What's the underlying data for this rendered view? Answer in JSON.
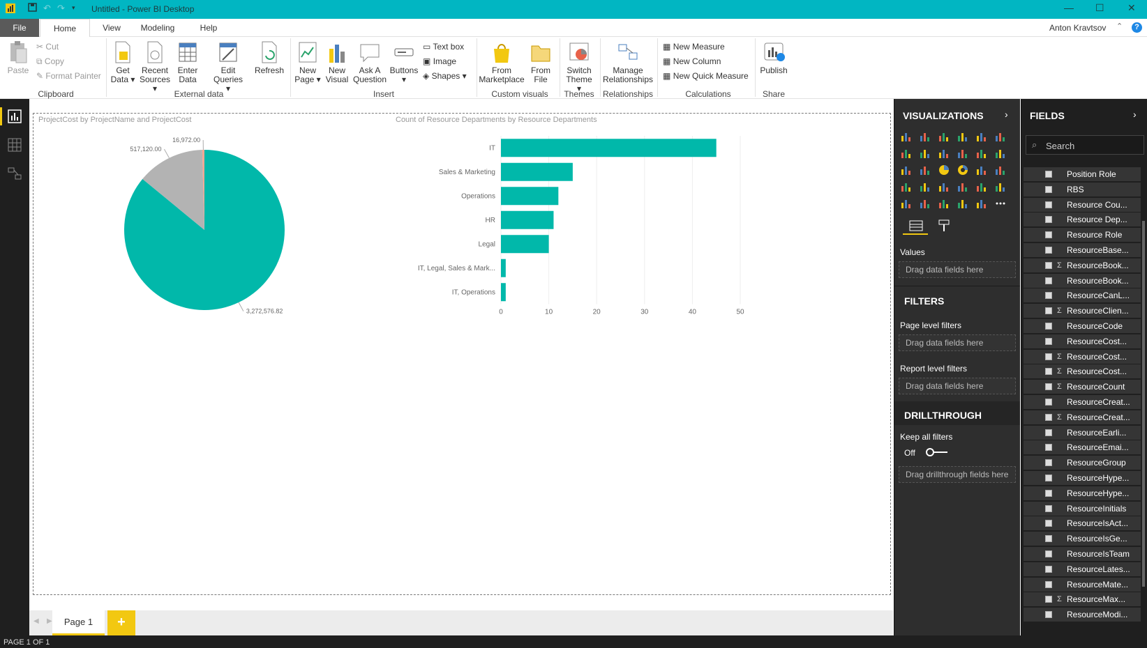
{
  "window": {
    "title": "Untitled - Power BI Desktop"
  },
  "menu": {
    "file": "File",
    "home": "Home",
    "view": "View",
    "modeling": "Modeling",
    "help": "Help",
    "user": "Anton Kravtsov",
    "help_glyph": "?"
  },
  "ribbon": {
    "clipboard": {
      "paste": "Paste",
      "cut": "Cut",
      "copy": "Copy",
      "format_painter": "Format Painter",
      "label": "Clipboard"
    },
    "external": {
      "get_data": "Get",
      "get_data2": "Data",
      "recent": "Recent",
      "recent2": "Sources",
      "enter": "Enter",
      "enter2": "Data",
      "edit": "Edit",
      "edit2": "Queries",
      "refresh": "Refresh",
      "label": "External data"
    },
    "insert": {
      "new_page": "New",
      "new_page2": "Page",
      "new_visual": "New",
      "new_visual2": "Visual",
      "ask": "Ask A",
      "ask2": "Question",
      "buttons": "Buttons",
      "text_box": "Text box",
      "image": "Image",
      "shapes": "Shapes",
      "label": "Insert"
    },
    "custom": {
      "marketplace": "From",
      "marketplace2": "Marketplace",
      "file": "From",
      "file2": "File",
      "label": "Custom visuals"
    },
    "themes": {
      "switch": "Switch",
      "switch2": "Theme",
      "label": "Themes"
    },
    "relationships": {
      "manage": "Manage",
      "manage2": "Relationships",
      "label": "Relationships"
    },
    "calculations": {
      "new_measure": "New Measure",
      "new_column": "New Column",
      "new_quick": "New Quick Measure",
      "label": "Calculations"
    },
    "share": {
      "publish": "Publish",
      "label": "Share"
    }
  },
  "pie": {
    "title": "ProjectCost by ProjectName and ProjectCost",
    "labels": [
      "16,972.00",
      "517,120.00",
      "3,272,576.82"
    ]
  },
  "chart_data": {
    "type": "bar",
    "title": "Count of Resource Departments by Resource Departments",
    "categories": [
      "IT",
      "Sales & Marketing",
      "Operations",
      "HR",
      "Legal",
      "IT, Legal, Sales & Mark...",
      "IT, Operations"
    ],
    "values": [
      45,
      15,
      12,
      11,
      10,
      1,
      1
    ],
    "xlim": [
      0,
      50
    ],
    "ticks": [
      "0",
      "10",
      "20",
      "30",
      "40",
      "50"
    ],
    "color": "#01b8aa"
  },
  "pie_data": {
    "values": [
      3272576.82,
      517120.0,
      16972.0
    ],
    "colors": [
      "#01b8aa",
      "#b3b3b3",
      "#f0a894"
    ]
  },
  "pages": {
    "page1": "Page 1",
    "add": "+"
  },
  "status": "PAGE 1 OF 1",
  "viz": {
    "title": "VISUALIZATIONS",
    "values": "Values",
    "drag1": "Drag data fields here",
    "filters": "FILTERS",
    "page_filters": "Page level filters",
    "drag2": "Drag data fields here",
    "report_filters": "Report level filters",
    "drag3": "Drag data fields here",
    "drill": "DRILLTHROUGH",
    "keep": "Keep all filters",
    "off": "Off",
    "drag4": "Drag drillthrough fields here"
  },
  "fields_panel": {
    "title": "FIELDS",
    "search_placeholder": "Search",
    "items": [
      {
        "name": "Position Role",
        "sigma": ""
      },
      {
        "name": "RBS",
        "sigma": ""
      },
      {
        "name": "Resource Cou...",
        "sigma": ""
      },
      {
        "name": "Resource Dep...",
        "sigma": ""
      },
      {
        "name": "Resource Role",
        "sigma": ""
      },
      {
        "name": "ResourceBase...",
        "sigma": ""
      },
      {
        "name": "ResourceBook...",
        "sigma": "Σ"
      },
      {
        "name": "ResourceBook...",
        "sigma": ""
      },
      {
        "name": "ResourceCanL...",
        "sigma": ""
      },
      {
        "name": "ResourceClien...",
        "sigma": "Σ"
      },
      {
        "name": "ResourceCode",
        "sigma": ""
      },
      {
        "name": "ResourceCost...",
        "sigma": ""
      },
      {
        "name": "ResourceCost...",
        "sigma": "Σ"
      },
      {
        "name": "ResourceCost...",
        "sigma": "Σ"
      },
      {
        "name": "ResourceCount",
        "sigma": "Σ"
      },
      {
        "name": "ResourceCreat...",
        "sigma": ""
      },
      {
        "name": "ResourceCreat...",
        "sigma": "Σ"
      },
      {
        "name": "ResourceEarli...",
        "sigma": ""
      },
      {
        "name": "ResourceEmai...",
        "sigma": ""
      },
      {
        "name": "ResourceGroup",
        "sigma": ""
      },
      {
        "name": "ResourceHype...",
        "sigma": ""
      },
      {
        "name": "ResourceHype...",
        "sigma": ""
      },
      {
        "name": "ResourceInitials",
        "sigma": ""
      },
      {
        "name": "ResourceIsAct...",
        "sigma": ""
      },
      {
        "name": "ResourceIsGe...",
        "sigma": ""
      },
      {
        "name": "ResourceIsTeam",
        "sigma": ""
      },
      {
        "name": "ResourceLates...",
        "sigma": ""
      },
      {
        "name": "ResourceMate...",
        "sigma": ""
      },
      {
        "name": "ResourceMax...",
        "sigma": "Σ"
      },
      {
        "name": "ResourceModi...",
        "sigma": ""
      }
    ]
  }
}
